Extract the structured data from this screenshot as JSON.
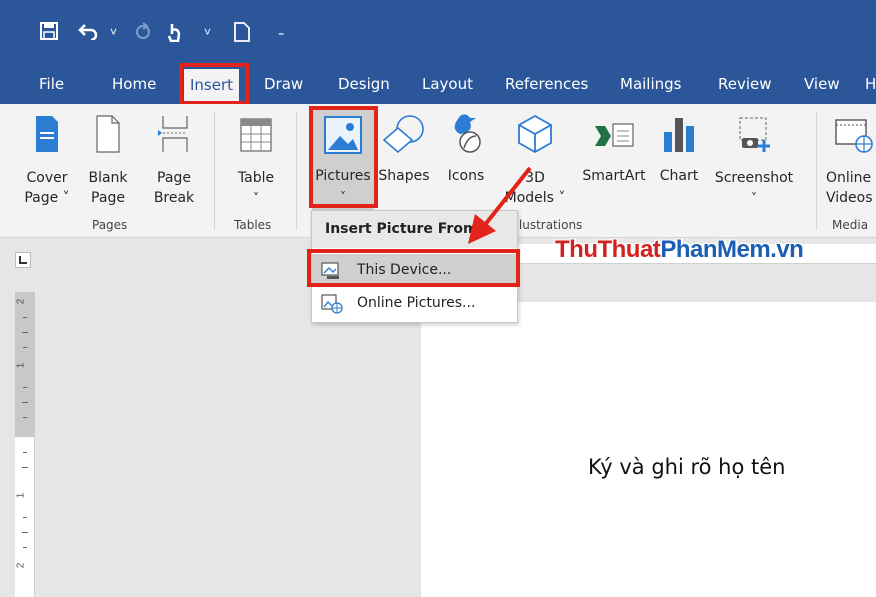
{
  "tabs": [
    "File",
    "Home",
    "Insert",
    "Draw",
    "Design",
    "Layout",
    "References",
    "Mailings",
    "Review",
    "View",
    "H"
  ],
  "active_tab": "Insert",
  "ribbon": {
    "cover_page": [
      "Cover",
      "Page ˅"
    ],
    "blank_page": [
      "Blank",
      "Page"
    ],
    "page_break": [
      "Page",
      "Break"
    ],
    "table": [
      "Table",
      "˅"
    ],
    "pictures": [
      "Pictures",
      "˅"
    ],
    "shapes": "Shapes",
    "icons": "Icons",
    "models_3d": [
      "3D",
      "Models ˅"
    ],
    "smartart": "SmartArt",
    "chart": "Chart",
    "screenshot": [
      "Screenshot",
      "˅"
    ],
    "online_videos": [
      "Online",
      "Videos"
    ],
    "groups": {
      "pages": "Pages",
      "tables": "Tables",
      "illustrations": "Illustrations",
      "media": "Media"
    }
  },
  "dropdown": {
    "header": "Insert Picture From",
    "items": [
      "This Device...",
      "Online Pictures..."
    ]
  },
  "watermark": {
    "part1": "ThuThuat",
    "part2": "PhanMem.vn"
  },
  "document": {
    "text": "Ký và ghi rõ họ tên"
  },
  "ruler": {
    "vertical_numbers": [
      "2",
      "1",
      "1",
      "2"
    ]
  },
  "colors": {
    "accent": "#2b579a",
    "highlight": "#e2231a"
  }
}
